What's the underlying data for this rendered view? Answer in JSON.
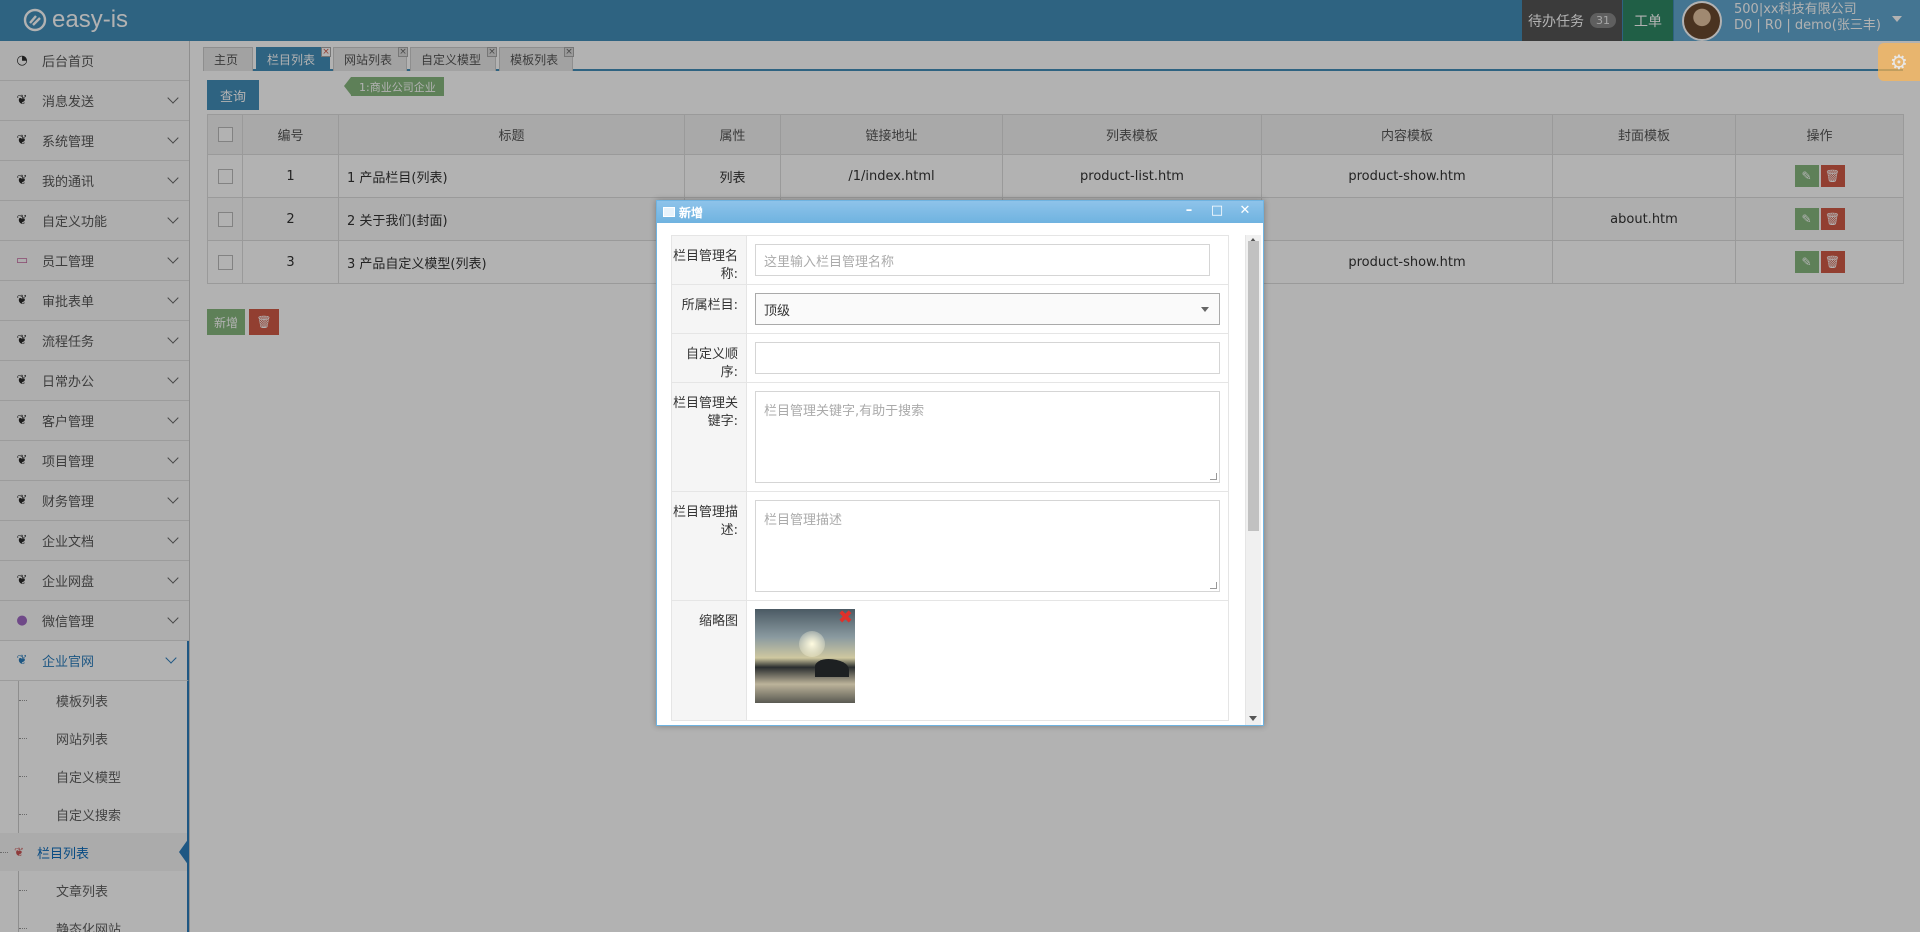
{
  "app": {
    "logo_text": "easy-is"
  },
  "topbar": {
    "todo_label": "待办任务",
    "todo_count": "31",
    "workorder_label": "工单",
    "user_company": "500|xx科技有限公司",
    "user_info": "D0 | R0 | demo(张三丰)"
  },
  "sidebar": {
    "items": [
      {
        "label": "后台首页",
        "icon": "dashboard-icon"
      },
      {
        "label": "消息发送",
        "icon": "leaf-icon"
      },
      {
        "label": "系统管理",
        "icon": "leaf-icon"
      },
      {
        "label": "我的通讯",
        "icon": "leaf-icon"
      },
      {
        "label": "自定义功能",
        "icon": "leaf-icon"
      },
      {
        "label": "员工管理",
        "icon": "laptop-icon"
      },
      {
        "label": "审批表单",
        "icon": "leaf-icon"
      },
      {
        "label": "流程任务",
        "icon": "leaf-icon"
      },
      {
        "label": "日常办公",
        "icon": "leaf-icon"
      },
      {
        "label": "客户管理",
        "icon": "leaf-icon"
      },
      {
        "label": "项目管理",
        "icon": "leaf-icon"
      },
      {
        "label": "财务管理",
        "icon": "leaf-icon"
      },
      {
        "label": "企业文档",
        "icon": "leaf-icon"
      },
      {
        "label": "企业网盘",
        "icon": "leaf-icon"
      },
      {
        "label": "微信管理",
        "icon": "chat-icon"
      },
      {
        "label": "企业官网",
        "icon": "leaf-icon"
      }
    ],
    "subitems": [
      "模板列表",
      "网站列表",
      "自定义模型",
      "自定义搜索",
      "栏目列表",
      "文章列表",
      "静态化网站"
    ]
  },
  "tabs": [
    {
      "label": "主页"
    },
    {
      "label": "栏目列表"
    },
    {
      "label": "网站列表"
    },
    {
      "label": "自定义模型"
    },
    {
      "label": "模板列表"
    }
  ],
  "toolbar": {
    "query_label": "查询",
    "category_tag": "1:商业公司企业",
    "add_label": "新增",
    "delete_icon": "trash-icon"
  },
  "table": {
    "headers": [
      "编号",
      "标题",
      "属性",
      "链接地址",
      "列表模板",
      "内容模板",
      "封面模板",
      "操作"
    ],
    "rows": [
      {
        "id": "1",
        "title": "1 产品栏目(列表)",
        "attr": "列表",
        "link": "/1/index.html",
        "list_tpl": "product-list.htm",
        "content_tpl": "product-show.htm",
        "cover_tpl": ""
      },
      {
        "id": "2",
        "title": "2 关于我们(封面)",
        "attr": "",
        "link": "",
        "list_tpl": "",
        "content_tpl": "",
        "cover_tpl": "about.htm"
      },
      {
        "id": "3",
        "title": "3 产品自定义模型(列表)",
        "attr": "",
        "link": "",
        "list_tpl": "",
        "content_tpl": "product-show.htm",
        "cover_tpl": ""
      }
    ]
  },
  "dialog": {
    "title": "新增",
    "fields": {
      "name_label": "栏目管理名称:",
      "name_placeholder": "这里输入栏目管理名称",
      "parent_label": "所属栏目:",
      "parent_value": "顶级",
      "order_label": "自定义顺序:",
      "order_value": "",
      "keywords_label": "栏目管理关键字:",
      "keywords_placeholder": "栏目管理关键字,有助于搜索",
      "desc_label": "栏目管理描述:",
      "desc_placeholder": "栏目管理描述",
      "thumb_label": "缩略图"
    }
  },
  "colors": {
    "brand": "#438eb9",
    "success": "#87b87f",
    "danger": "#d15b47",
    "workorder": "#2e8965"
  }
}
